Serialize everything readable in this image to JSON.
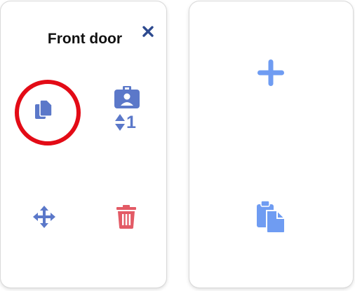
{
  "left_card": {
    "title": "Front door",
    "close_icon": "close-icon",
    "actions": [
      {
        "name": "duplicate",
        "icon": "copy-icon"
      },
      {
        "name": "reorder-badge",
        "icon": "badge-sort-icon",
        "order_value": "1"
      },
      {
        "name": "move",
        "icon": "move-arrows-icon"
      },
      {
        "name": "delete",
        "icon": "trash-icon"
      }
    ]
  },
  "right_card": {
    "actions": [
      {
        "name": "add",
        "icon": "plus-icon"
      },
      {
        "name": "paste",
        "icon": "clipboard-paste-icon"
      }
    ]
  },
  "annotation": {
    "highlight_target": "duplicate",
    "color": "#e30b16"
  },
  "colors": {
    "icon_blue": "#5b78c9",
    "icon_light_blue": "#6f9cf2",
    "close_dark_blue": "#2d4a8f",
    "delete_red": "#e35b66",
    "card_bg": "#ffffff"
  }
}
